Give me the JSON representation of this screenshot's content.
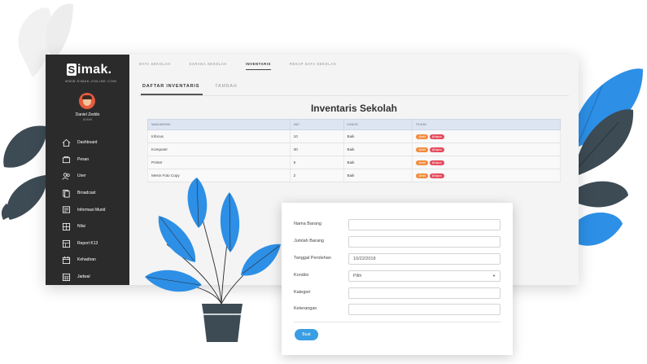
{
  "app": {
    "logo_letter": "S",
    "logo_text": "imak.",
    "logo_subtitle": "WWW.SIMAK-ONLINE.COM"
  },
  "user": {
    "name": "Daniel Zeddo",
    "role": "ADMIN"
  },
  "sidebar": {
    "items": [
      {
        "label": "Dashboard",
        "icon": "home-icon"
      },
      {
        "label": "Pesan",
        "icon": "message-icon"
      },
      {
        "label": "User",
        "icon": "users-icon"
      },
      {
        "label": "Broadcast",
        "icon": "broadcast-icon"
      },
      {
        "label": "Informasi Murid",
        "icon": "student-info-icon"
      },
      {
        "label": "Nilai",
        "icon": "grade-icon"
      },
      {
        "label": "Report K13",
        "icon": "report-icon"
      },
      {
        "label": "Kehadiran",
        "icon": "calendar-icon"
      },
      {
        "label": "Jadwal",
        "icon": "schedule-icon"
      }
    ]
  },
  "topnav": {
    "tabs": [
      "DATA SEKOLAH",
      "SARANA SEKOLAH",
      "INVENTARIS",
      "REKAP DATA SEKOLAH"
    ],
    "active": "INVENTARIS"
  },
  "subtabs": {
    "items": [
      "DAFTAR INVENTARIS",
      "TAMBAH"
    ],
    "active": "DAFTAR INVENTARIS"
  },
  "page_title": "Inventaris Sekolah",
  "table": {
    "headers": [
      "NAMA BARANG",
      "UNIT",
      "KONDISI",
      "PILIHAN"
    ],
    "rows": [
      {
        "nama": "Infocus",
        "unit": "10",
        "kondisi": "Baik"
      },
      {
        "nama": "Komputer",
        "unit": "30",
        "kondisi": "Baik"
      },
      {
        "nama": "Printer",
        "unit": "5",
        "kondisi": "Baik"
      },
      {
        "nama": "Mesin Foto Copy",
        "unit": "2",
        "kondisi": "Baik"
      }
    ],
    "edit_label": "@edit",
    "delete_label": "@hapus"
  },
  "form": {
    "fields": {
      "nama_barang": {
        "label": "Nama Barang",
        "value": ""
      },
      "jumlah_barang": {
        "label": "Jumlah Barang",
        "value": ""
      },
      "tanggal": {
        "label": "Tanggal Perolehan",
        "value": "10/22/2018"
      },
      "kondisi": {
        "label": "Kondisi",
        "value": "Pilih"
      },
      "kategori": {
        "label": "Kategori",
        "value": ""
      },
      "keterangan": {
        "label": "Keterangan",
        "value": ""
      }
    },
    "submit_label": "Buat"
  },
  "colors": {
    "sidebar": "#2b2b2b",
    "accent_blue": "#3a9ee4",
    "badge_edit": "#f28b3c",
    "badge_delete": "#e54b5c",
    "leaf_blue": "#2d8fe6",
    "leaf_dark": "#3d4b55"
  }
}
